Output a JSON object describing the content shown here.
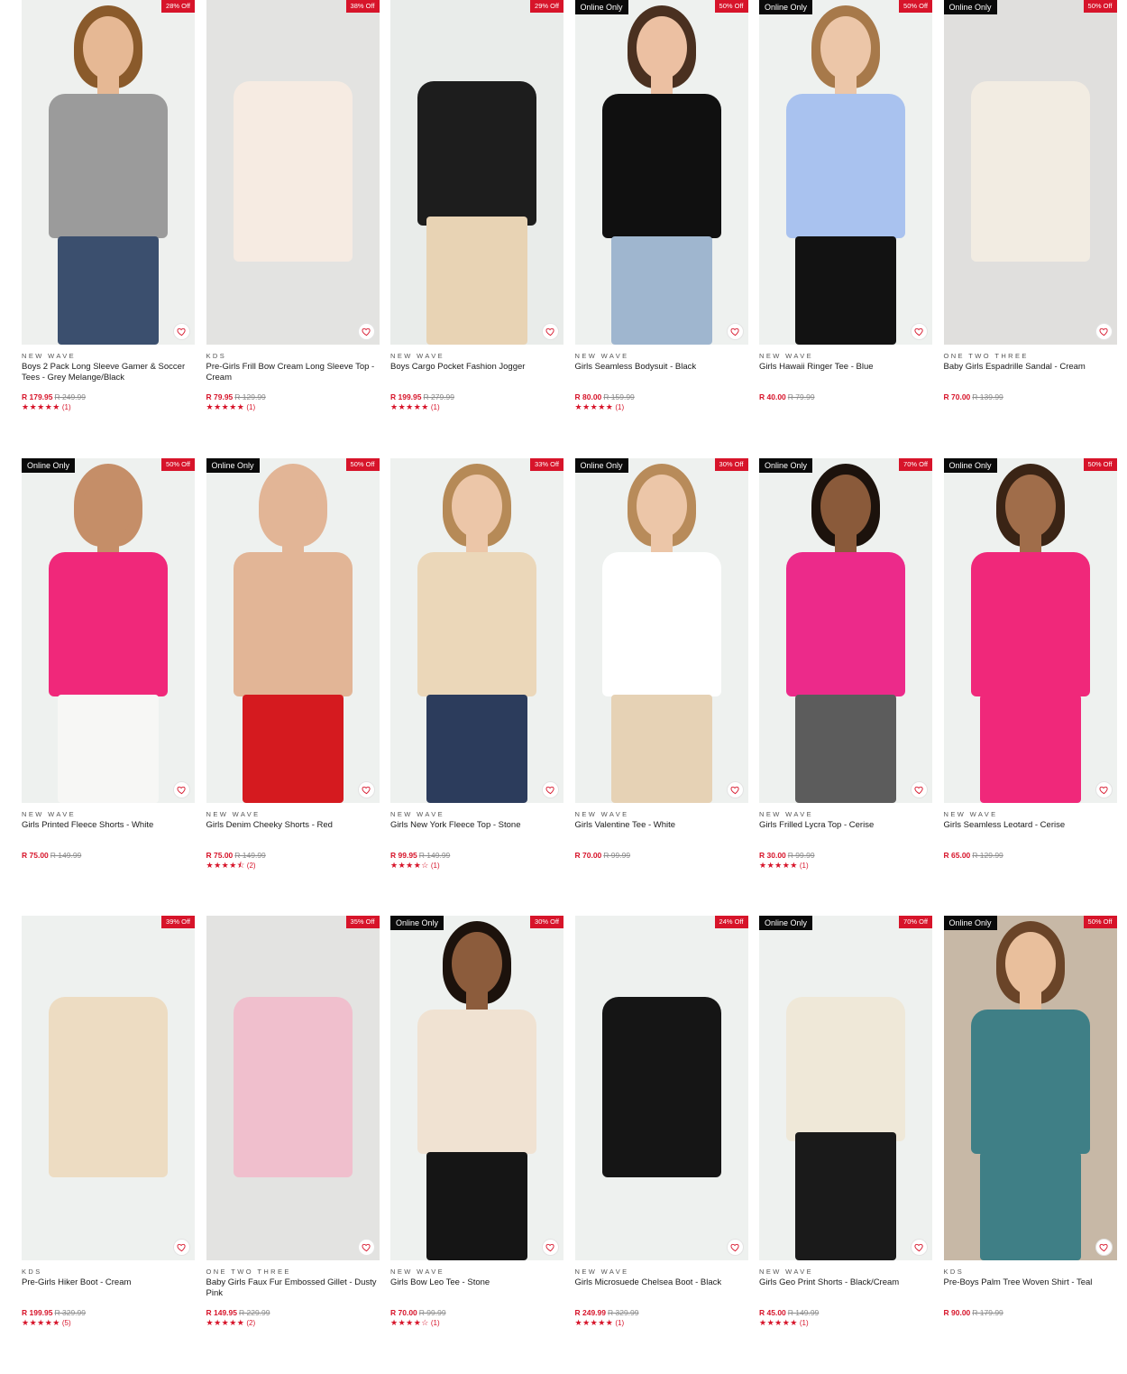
{
  "labels": {
    "online": "Online Only"
  },
  "colors": {
    "accent": "#d7142a",
    "online_bg": "#0a0a0a"
  },
  "products": [
    {
      "discount": "28% Off",
      "online": false,
      "brand": "NEW WAVE",
      "title": "Boys 2 Pack Long Sleeve Gamer & Soccer Tees - Grey Melange/Black",
      "price": "R 179.95",
      "was": "R 249.99",
      "stars": "★★★★★",
      "count": "(1)",
      "bg": "#eef0ee",
      "top": "#9b9b9b",
      "bottom": "#3b4f6e",
      "skin": "#e6b894",
      "hairc": "#8a5a2b"
    },
    {
      "discount": "38% Off",
      "online": false,
      "brand": "KDS",
      "title": "Pre-Girls Frill Bow Cream Long Sleeve Top - Cream",
      "price": "R 79.95",
      "was": "R 129.99",
      "stars": "★★★★★",
      "count": "(1)",
      "bg": "#e3e3e1",
      "top": "#f6ebe2",
      "bottom": "",
      "skin": "",
      "hairc": ""
    },
    {
      "discount": "29% Off",
      "online": false,
      "brand": "NEW WAVE",
      "title": "Boys Cargo Pocket Fashion Jogger",
      "price": "R 199.95",
      "was": "R 279.99",
      "stars": "★★★★★",
      "count": "(1)",
      "bg": "#e9ecea",
      "top": "#1d1d1d",
      "bottom": "#e8d3b4",
      "skin": "",
      "hairc": ""
    },
    {
      "discount": "50% Off",
      "online": true,
      "brand": "NEW WAVE",
      "title": "Girls Seamless Bodysuit - Black",
      "price": "R 80.00",
      "was": "R 159.99",
      "stars": "★★★★★",
      "count": "(1)",
      "bg": "#eef1ef",
      "top": "#101010",
      "bottom": "#9fb6cf",
      "skin": "#ecc0a2",
      "hairc": "#4a3020"
    },
    {
      "discount": "50% Off",
      "online": true,
      "brand": "NEW WAVE",
      "title": "Girls Hawaii Ringer Tee - Blue",
      "price": "R 40.00",
      "was": "R 79.99",
      "stars": "",
      "count": "",
      "bg": "#eef1ef",
      "top": "#a9c2ef",
      "bottom": "#121212",
      "skin": "#ecc6a8",
      "hairc": "#a7794a"
    },
    {
      "discount": "50% Off",
      "online": true,
      "brand": "ONE TWO THREE",
      "title": "Baby Girls Espadrille Sandal - Cream",
      "price": "R 70.00",
      "was": "R 139.99",
      "stars": "",
      "count": "",
      "bg": "#e0dfdd",
      "top": "#f2ece2",
      "bottom": "",
      "skin": "",
      "hairc": ""
    },
    {
      "discount": "50% Off",
      "online": true,
      "brand": "NEW WAVE",
      "title": "Girls Printed Fleece Shorts - White",
      "price": "R 75.00",
      "was": "R 149.99",
      "stars": "",
      "count": "",
      "bg": "#eef1ef",
      "top": "#f0287a",
      "bottom": "#f7f7f5",
      "skin": "#c58e68",
      "hairc": ""
    },
    {
      "discount": "50% Off",
      "online": true,
      "brand": "NEW WAVE",
      "title": "Girls Denim Cheeky Shorts - Red",
      "price": "R 75.00",
      "was": "R 149.99",
      "stars": "★★★★⯪",
      "count": "(2)",
      "bg": "#eef1ef",
      "top": "#e2b596",
      "bottom": "#d51a1f",
      "skin": "#e2b596",
      "hairc": ""
    },
    {
      "discount": "33% Off",
      "online": false,
      "brand": "NEW WAVE",
      "title": "Girls New York Fleece Top - Stone",
      "price": "R 99.95",
      "was": "R 149.99",
      "stars": "★★★★☆",
      "count": "(1)",
      "bg": "#eef1ef",
      "top": "#ebd7b9",
      "bottom": "#2c3c5c",
      "skin": "#ecc6a8",
      "hairc": "#b68a57"
    },
    {
      "discount": "30% Off",
      "online": true,
      "brand": "NEW WAVE",
      "title": "Girls Valentine Tee - White",
      "price": "R 70.00",
      "was": "R 99.99",
      "stars": "",
      "count": "",
      "bg": "#eef1ef",
      "top": "#ffffff",
      "bottom": "#e6d2b5",
      "skin": "#ecc6a8",
      "hairc": "#b88b5a"
    },
    {
      "discount": "70% Off",
      "online": true,
      "brand": "NEW WAVE",
      "title": "Girls Frilled Lycra Top - Cerise",
      "price": "R 30.00",
      "was": "R 99.99",
      "stars": "★★★★★",
      "count": "(1)",
      "bg": "#eef1ef",
      "top": "#ec2a8a",
      "bottom": "#5c5c5c",
      "skin": "#8a5a3a",
      "hairc": "#1c120c"
    },
    {
      "discount": "50% Off",
      "online": true,
      "brand": "NEW WAVE",
      "title": "Girls Seamless Leotard - Cerise",
      "price": "R 65.00",
      "was": "R 129.99",
      "stars": "",
      "count": "",
      "bg": "#eef1ef",
      "top": "#f0287a",
      "bottom": "#f0287a",
      "skin": "#a06d4a",
      "hairc": "#3a2415"
    },
    {
      "discount": "39% Off",
      "online": false,
      "brand": "KDS",
      "title": "Pre-Girls Hiker Boot - Cream",
      "price": "R 199.95",
      "was": "R 329.99",
      "stars": "★★★★★",
      "count": "(5)",
      "bg": "#eef1ef",
      "top": "#eddcc2",
      "bottom": "",
      "skin": "",
      "hairc": ""
    },
    {
      "discount": "35% Off",
      "online": false,
      "brand": "ONE TWO THREE",
      "title": "Baby Girls Faux Fur Embossed Gillet - Dusty Pink",
      "price": "R 149.95",
      "was": "R 229.99",
      "stars": "★★★★★",
      "count": "(2)",
      "bg": "#e3e3e1",
      "top": "#f0bfcd",
      "bottom": "",
      "skin": "",
      "hairc": ""
    },
    {
      "discount": "30% Off",
      "online": true,
      "brand": "NEW WAVE",
      "title": "Girls Bow Leo Tee - Stone",
      "price": "R 70.00",
      "was": "R 99.99",
      "stars": "★★★★☆",
      "count": "(1)",
      "bg": "#eef1ef",
      "top": "#f0e2d2",
      "bottom": "#151515",
      "skin": "#8c5c3c",
      "hairc": "#1c120c"
    },
    {
      "discount": "24% Off",
      "online": false,
      "brand": "NEW WAVE",
      "title": "Girls Microsuede Chelsea Boot - Black",
      "price": "R 249.99",
      "was": "R 329.99",
      "stars": "★★★★★",
      "count": "(1)",
      "bg": "#eef1ef",
      "top": "#151515",
      "bottom": "",
      "skin": "",
      "hairc": ""
    },
    {
      "discount": "70% Off",
      "online": true,
      "brand": "NEW WAVE",
      "title": "Girls Geo Print Shorts - Black/Cream",
      "price": "R 45.00",
      "was": "R 149.99",
      "stars": "★★★★★",
      "count": "(1)",
      "bg": "#eef1ef",
      "top": "#efe8d8",
      "bottom": "#1a1a1a",
      "skin": "",
      "hairc": ""
    },
    {
      "discount": "50% Off",
      "online": true,
      "brand": "KDS",
      "title": "Pre-Boys Palm Tree Woven Shirt - Teal",
      "price": "R 90.00",
      "was": "R 179.99",
      "stars": "",
      "count": "",
      "bg": "#c7b8a6",
      "top": "#3f7f86",
      "bottom": "#3f7f86",
      "skin": "#e9bf9c",
      "hairc": "#6a4428"
    }
  ]
}
